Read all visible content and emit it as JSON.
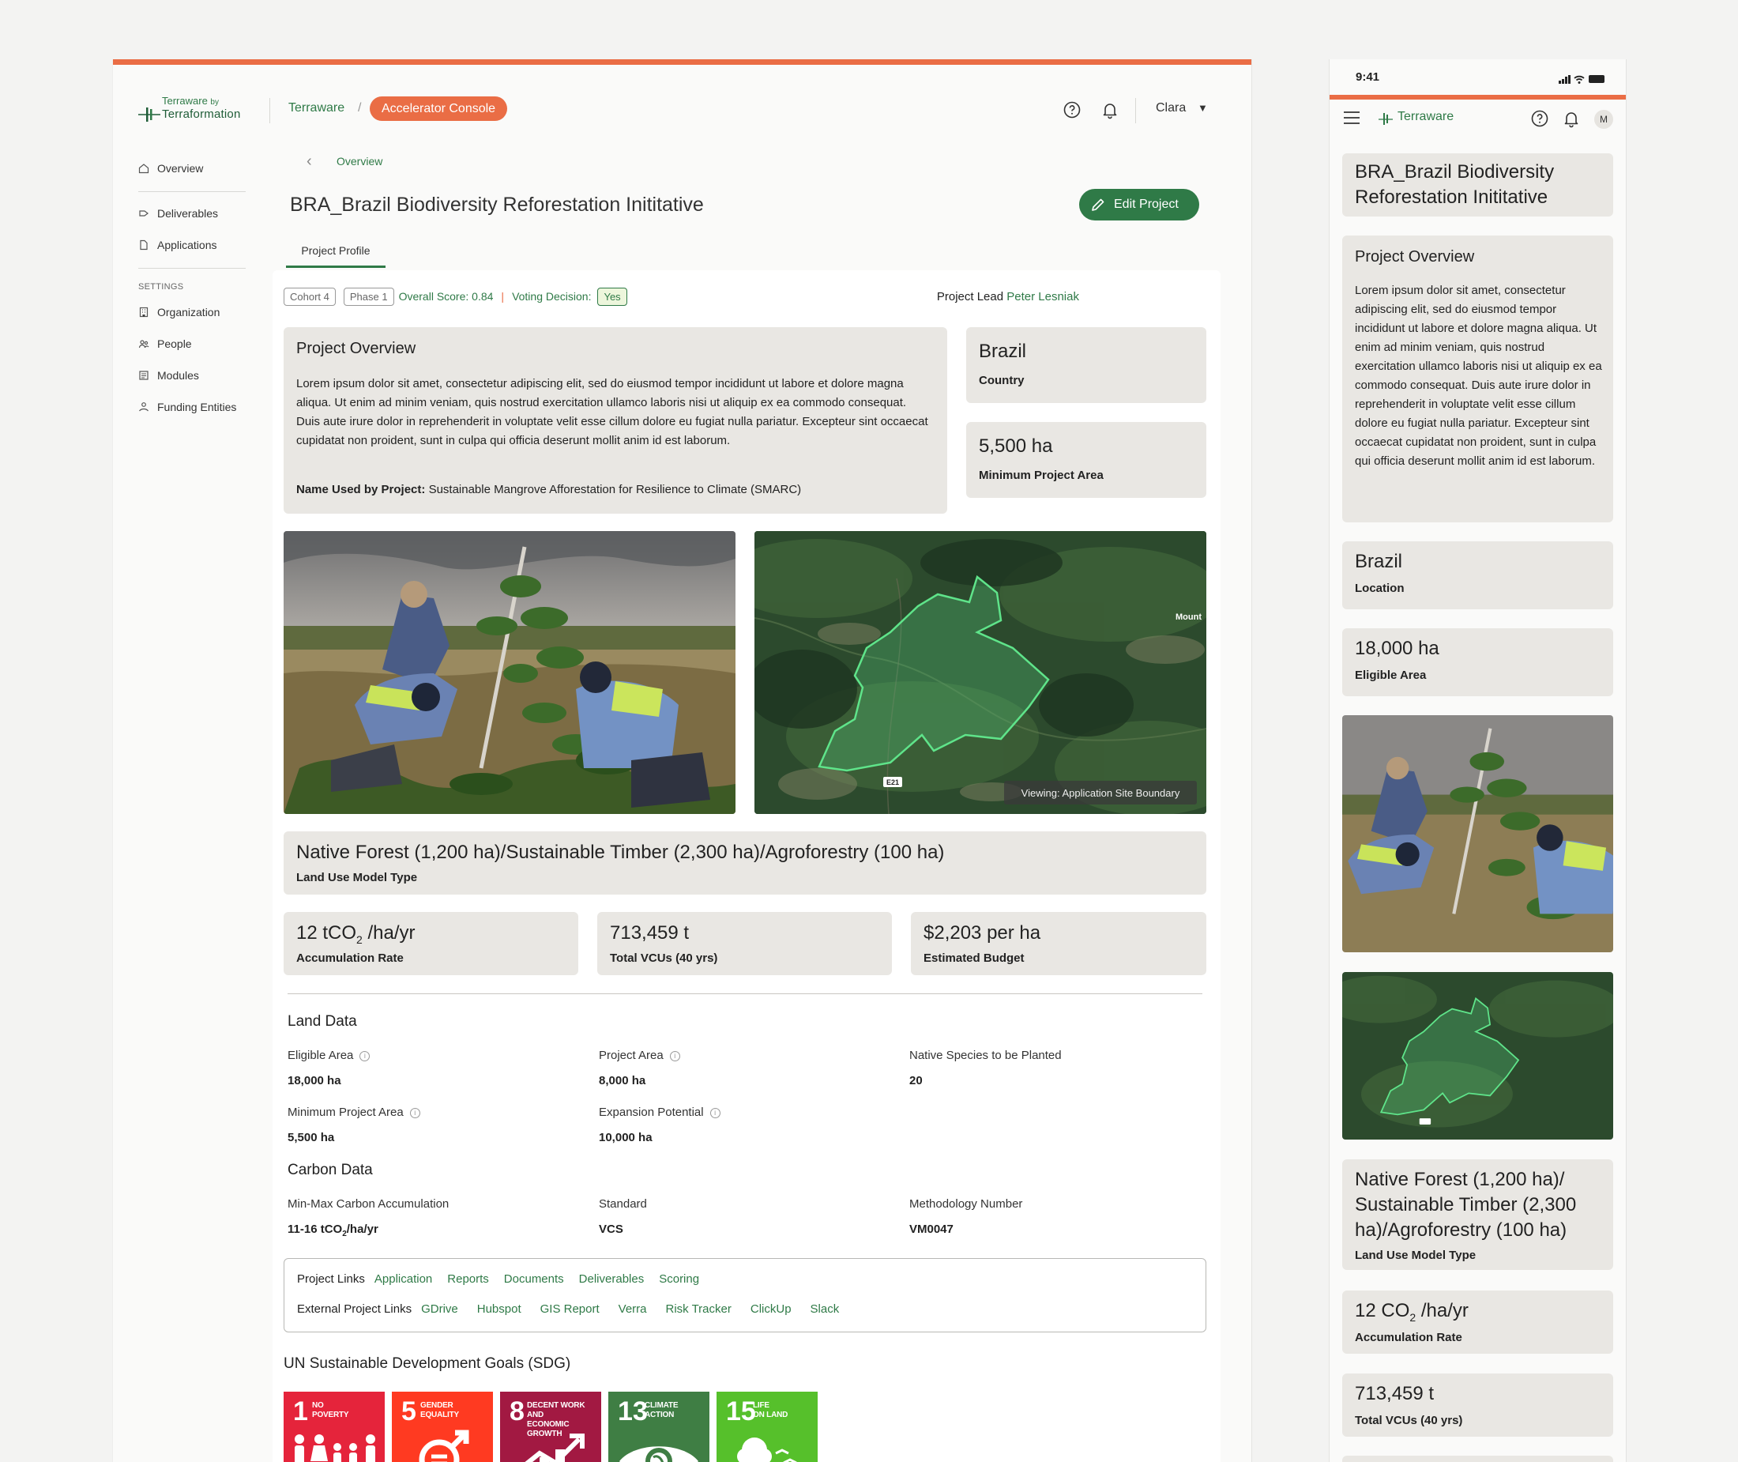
{
  "desktop": {
    "logo": {
      "line1": "Terraware",
      "by": "by",
      "line2": "Terraformation"
    },
    "breadcrumb": {
      "home": "Terraware",
      "separator": "/",
      "console": "Accelerator Console"
    },
    "user": {
      "name": "Clara"
    },
    "sidebar": {
      "items": [
        {
          "label": "Overview"
        },
        {
          "label": "Deliverables"
        },
        {
          "label": "Applications"
        }
      ],
      "settings_heading": "SETTINGS",
      "settings_items": [
        {
          "label": "Organization"
        },
        {
          "label": "People"
        },
        {
          "label": "Modules"
        },
        {
          "label": "Funding Entities"
        }
      ]
    },
    "page": {
      "back_label": "Overview",
      "title": "BRA_Brazil Biodiversity Reforestation Inititative",
      "edit_button": "Edit Project",
      "tab": "Project Profile",
      "tags": {
        "cohort": "Cohort 4",
        "phase": "Phase 1",
        "score": "Overall Score: 0.84",
        "divider": "|",
        "voting": "Voting Decision:",
        "decision": "Yes"
      },
      "lead": {
        "label": "Project Lead",
        "name": "Peter Lesniak"
      }
    },
    "overview": {
      "heading": "Project Overview",
      "body": "Lorem ipsum dolor sit amet, consectetur adipiscing elit, sed do eiusmod tempor incididunt ut labore et dolore magna aliqua. Ut enim ad minim veniam, quis nostrud exercitation ullamco laboris nisi ut aliquip ex ea commodo consequat. Duis aute irure dolor in reprehenderit in voluptate velit esse cillum dolore eu fugiat nulla pariatur. Excepteur sint occaecat cupidatat non proident, sunt in culpa qui officia deserunt mollit anim id est laborum.",
      "name_label": "Name Used by Project:",
      "name_value": "Sustainable Mangrove Afforestation for Resilience to Climate (SMARC)"
    },
    "country": {
      "value": "Brazil",
      "label": "Country"
    },
    "min_area": {
      "value": "5,500 ha",
      "label": "Minimum Project Area"
    },
    "map": {
      "viewing": "Viewing: Application Site Boundary",
      "place": "Mount",
      "road": "E21"
    },
    "land_use": {
      "value": "Native Forest (1,200 ha)/Sustainable Timber (2,300 ha)/Agroforestry (100 ha)",
      "label": "Land Use Model Type"
    },
    "stats": [
      {
        "value_pre": "12 tCO",
        "sub": "2",
        "value_post": " /ha/yr",
        "label": "Accumulation Rate"
      },
      {
        "value": "713,459 t",
        "label": "Total VCUs (40 yrs)"
      },
      {
        "value": "$2,203 per ha",
        "label": "Estimated Budget"
      }
    ],
    "land_data": {
      "heading": "Land Data",
      "fields": [
        {
          "label": "Eligible Area",
          "value": "18,000 ha"
        },
        {
          "label": "Project Area",
          "value": "8,000 ha"
        },
        {
          "label": "Native Species to be Planted",
          "value": "20"
        },
        {
          "label": "Minimum Project Area",
          "value": "5,500 ha"
        },
        {
          "label": "Expansion Potential",
          "value": "10,000 ha"
        }
      ]
    },
    "carbon_data": {
      "heading": "Carbon Data",
      "fields": [
        {
          "label": "Min-Max Carbon Accumulation",
          "value_pre": "11-16 tCO",
          "sub": "2",
          "value_post": "/ha/yr"
        },
        {
          "label": "Standard",
          "value": "VCS"
        },
        {
          "label": "Methodology Number",
          "value": "VM0047"
        }
      ]
    },
    "links": {
      "project_heading": "Project Links",
      "project": [
        "Application",
        "Reports",
        "Documents",
        "Deliverables",
        "Scoring"
      ],
      "external_heading": "External Project Links",
      "external": [
        "GDrive",
        "Hubspot",
        "GIS Report",
        "Verra",
        "Risk Tracker",
        "ClickUp",
        "Slack"
      ]
    },
    "sdg": {
      "heading": "UN Sustainable Development Goals (SDG)",
      "goals": [
        {
          "num": "1",
          "line1": "NO",
          "line2": "POVERTY",
          "color": "#e5243b"
        },
        {
          "num": "5",
          "line1": "GENDER",
          "line2": "EQUALITY",
          "color": "#ff3a21"
        },
        {
          "num": "8",
          "line1": "DECENT WORK AND",
          "line2": "ECONOMIC GROWTH",
          "color": "#a21942"
        },
        {
          "num": "13",
          "line1": "CLIMATE",
          "line2": "ACTION",
          "color": "#3f7e44"
        },
        {
          "num": "15",
          "line1": "LIFE",
          "line2": "ON LAND",
          "color": "#56c02b"
        }
      ]
    }
  },
  "mobile": {
    "time": "9:41",
    "brand": "Terraware",
    "avatar": "M",
    "title": "BRA_Brazil Biodiversity Reforestation Inititative",
    "overview_heading": "Project Overview",
    "overview_body": "Lorem ipsum dolor sit amet, consectetur adipiscing elit, sed do eiusmod tempor incididunt ut labore et dolore magna aliqua. Ut enim ad minim veniam, quis nostrud exercitation ullamco laboris nisi ut aliquip ex ea commodo consequat. Duis aute irure dolor in reprehenderit in voluptate velit esse cillum dolore eu fugiat nulla pariatur. Excepteur sint occaecat cupidatat non proident, sunt in culpa qui officia deserunt mollit anim id est laborum.",
    "location": {
      "value": "Brazil",
      "label": "Location"
    },
    "eligible": {
      "value": "18,000 ha",
      "label": "Eligible Area"
    },
    "land_use": {
      "value": "Native Forest (1,200 ha)/ Sustainable Timber (2,300 ha)/Agroforestry (100 ha)",
      "label": "Land Use Model Type"
    },
    "accum": {
      "value_pre": "12 CO",
      "sub": "2",
      "value_post": " /ha/yr",
      "label": "Accumulation Rate"
    },
    "vcus": {
      "value": "713,459 t",
      "label": "Total VCUs (40 yrs)"
    }
  }
}
